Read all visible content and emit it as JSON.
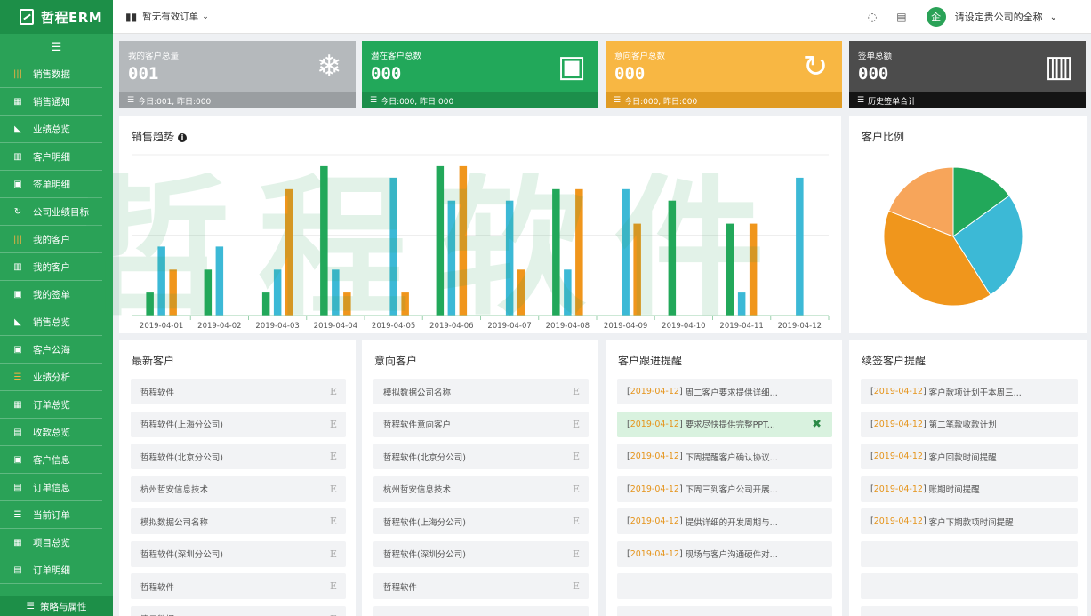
{
  "app": {
    "name": "哲程ERM"
  },
  "sidebar": {
    "items": [
      {
        "label": "销售数据",
        "icon": "bars-icon",
        "glyph": "|||",
        "highlight": true
      },
      {
        "label": "销售通知",
        "icon": "grid-icon",
        "glyph": "▦",
        "highlight": false
      },
      {
        "label": "业绩总览",
        "icon": "area-chart-icon",
        "glyph": "◣",
        "highlight": false
      },
      {
        "label": "客户明细",
        "icon": "bar-chart-icon",
        "glyph": "▥",
        "highlight": false
      },
      {
        "label": "签单明细",
        "icon": "contact-card-icon",
        "glyph": "▣",
        "highlight": false
      },
      {
        "label": "公司业绩目标",
        "icon": "target-icon",
        "glyph": "↻",
        "highlight": false
      },
      {
        "label": "我的客户",
        "icon": "bars-icon",
        "glyph": "|||",
        "highlight": true
      },
      {
        "label": "我的客户",
        "icon": "bar-chart-icon",
        "glyph": "▥",
        "highlight": false
      },
      {
        "label": "我的签单",
        "icon": "contact-card-icon",
        "glyph": "▣",
        "highlight": false
      },
      {
        "label": "销售总览",
        "icon": "area-chart-icon",
        "glyph": "◣",
        "highlight": false
      },
      {
        "label": "客户公海",
        "icon": "contact-card-icon",
        "glyph": "▣",
        "highlight": false
      },
      {
        "label": "业绩分析",
        "icon": "list-icon",
        "glyph": "☰",
        "highlight": true
      },
      {
        "label": "订单总览",
        "icon": "grid-icon",
        "glyph": "▦",
        "highlight": false
      },
      {
        "label": "收款总览",
        "icon": "calendar-icon",
        "glyph": "▤",
        "highlight": false
      },
      {
        "label": "客户信息",
        "icon": "contact-card-icon",
        "glyph": "▣",
        "highlight": false
      },
      {
        "label": "订单信息",
        "icon": "document-icon",
        "glyph": "▤",
        "highlight": false
      },
      {
        "label": "当前订单",
        "icon": "list-icon",
        "glyph": "☰",
        "highlight": false
      },
      {
        "label": "项目总览",
        "icon": "grid-icon",
        "glyph": "▦",
        "highlight": false
      },
      {
        "label": "订单明细",
        "icon": "clipboard-icon",
        "glyph": "▤",
        "highlight": false
      }
    ],
    "bottom_label": "策略与属性"
  },
  "topbar": {
    "orders_label": "暂无有效订单",
    "company_label": "请设定贵公司的全称",
    "avatar_text": "企"
  },
  "stats": [
    {
      "label": "我的客户总量",
      "value": "001",
      "sub": "今日:001, 昨日:000",
      "icon": "snowflake-icon",
      "glyph": "❄",
      "color": "#b5b9bc",
      "subcolor": "#9a9ea1"
    },
    {
      "label": "潜在客户总数",
      "value": "000",
      "sub": "今日:000, 昨日:000",
      "icon": "contact-book-icon",
      "glyph": "▣",
      "color": "#22a85a",
      "subcolor": "#1c8f4b"
    },
    {
      "label": "意向客户总数",
      "value": "000",
      "sub": "今日:000, 昨日:000",
      "icon": "refresh-icon",
      "glyph": "↻",
      "color": "#f8b743",
      "subcolor": "#e09b23"
    },
    {
      "label": "签单总额",
      "value": "000",
      "sub": "历史签单合计",
      "icon": "bar-chart-icon",
      "glyph": "▥",
      "color": "#4c4c4c",
      "subcolor": "#141414"
    }
  ],
  "sales_trend": {
    "title": "销售趋势",
    "info": "i"
  },
  "customer_ratio": {
    "title": "客户比例"
  },
  "chart_data": [
    {
      "type": "bar",
      "categories": [
        "2019-04-01",
        "2019-04-02",
        "2019-04-03",
        "2019-04-04",
        "2019-04-05",
        "2019-04-06",
        "2019-04-07",
        "2019-04-08",
        "2019-04-09",
        "2019-04-10",
        "2019-04-11",
        "2019-04-12"
      ],
      "series": [
        {
          "color": "#22a85a",
          "values": [
            10,
            20,
            10,
            65,
            0,
            65,
            0,
            55,
            0,
            50,
            40,
            0
          ]
        },
        {
          "color": "#3cb9d6",
          "values": [
            30,
            30,
            20,
            20,
            60,
            50,
            50,
            20,
            55,
            0,
            10,
            60
          ]
        },
        {
          "color": "#f0961c",
          "values": [
            20,
            0,
            55,
            10,
            10,
            65,
            20,
            55,
            40,
            0,
            40,
            0
          ]
        }
      ],
      "ylim": [
        0,
        70
      ],
      "grid": true
    },
    {
      "type": "pie",
      "values": [
        15,
        26,
        40,
        19
      ],
      "colors": [
        "#22a85a",
        "#3cb9d6",
        "#f0961c",
        "#f7a55a"
      ]
    }
  ],
  "newest": {
    "title": "最新客户",
    "items": [
      "哲程软件",
      "哲程软件(上海分公司)",
      "哲程软件(北京分公司)",
      "杭州哲安信息技术",
      "模拟数据公司名称",
      "哲程软件(深圳分公司)",
      "哲程软件",
      "演示数据"
    ],
    "mark": "E"
  },
  "intent": {
    "title": "意向客户",
    "items": [
      "模拟数据公司名称",
      "哲程软件意向客户",
      "哲程软件(北京分公司)",
      "杭州哲安信息技术",
      "哲程软件(上海分公司)",
      "哲程软件(深圳分公司)",
      "哲程软件",
      ""
    ],
    "mark": "E"
  },
  "followup": {
    "title": "客户跟进提醒",
    "items": [
      {
        "date": "2019-04-12",
        "text": "周二客户要求提供详细..."
      },
      {
        "date": "2019-04-12",
        "text": "要求尽快提供完整PPT...",
        "selected": true
      },
      {
        "date": "2019-04-12",
        "text": "下周提醒客户确认协议..."
      },
      {
        "date": "2019-04-12",
        "text": "下周三到客户公司开展..."
      },
      {
        "date": "2019-04-12",
        "text": "提供详细的开发周期与..."
      },
      {
        "date": "2019-04-12",
        "text": "现场与客户沟通硬件对..."
      },
      {
        "date": "",
        "text": ""
      },
      {
        "date": "",
        "text": ""
      }
    ],
    "close_glyph": "✖"
  },
  "renewal": {
    "title": "续签客户提醒",
    "items": [
      {
        "date": "2019-04-12",
        "text": "客户款项计划于本周三..."
      },
      {
        "date": "2019-04-12",
        "text": "第二笔款收款计划"
      },
      {
        "date": "2019-04-12",
        "text": "客户回款时间提醒"
      },
      {
        "date": "2019-04-12",
        "text": "账期时间提醒"
      },
      {
        "date": "2019-04-12",
        "text": "客户下期款项时间提醒"
      },
      {
        "date": "",
        "text": ""
      },
      {
        "date": "",
        "text": ""
      },
      {
        "date": "",
        "text": ""
      }
    ]
  },
  "watermark": {
    "line1": "哲程软件",
    "line2": "哲程软件"
  }
}
